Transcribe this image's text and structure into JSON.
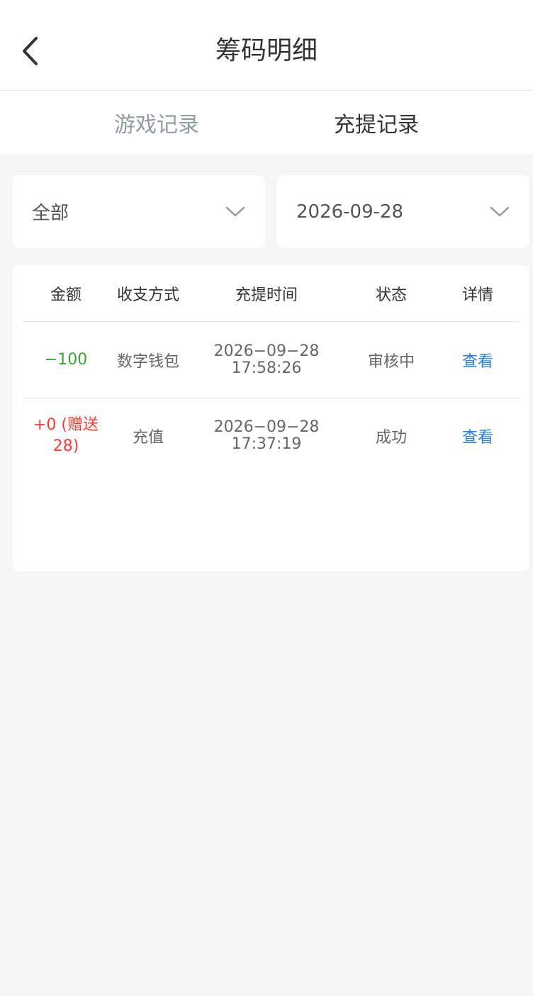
{
  "header": {
    "title": "筹码明细",
    "back_icon": "chevron-left-icon"
  },
  "tabs": [
    {
      "label": "游戏记录",
      "active": false
    },
    {
      "label": "充提记录",
      "active": true
    }
  ],
  "filters": {
    "type": {
      "value": "全部",
      "icon": "chevron-down-icon"
    },
    "date": {
      "value": "2026-09-28",
      "icon": "chevron-down-icon"
    }
  },
  "table": {
    "columns": [
      "金额",
      "收支方式",
      "充提时间",
      "状态",
      "详情"
    ],
    "rows": [
      {
        "amount": "−100",
        "method": "数字钱包",
        "date": "2026−09−28",
        "time": "17:58:26",
        "status": "审核中",
        "detail": "查看"
      },
      {
        "amount": "+0 (赠送28)",
        "method": "充值",
        "date": "2026−09−28",
        "time": "17:37:19",
        "status": "成功",
        "detail": "查看"
      }
    ]
  },
  "colors": {
    "negative": "#3aa535",
    "positive": "#ff3b30",
    "link": "#1e80ff"
  }
}
